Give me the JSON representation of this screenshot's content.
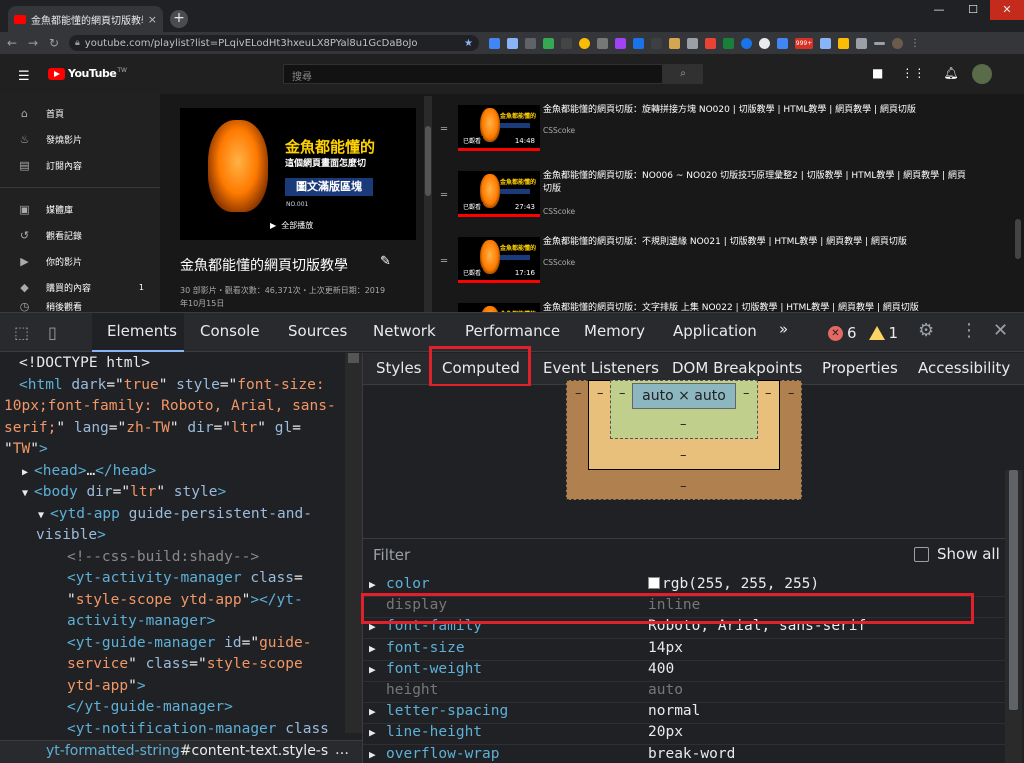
{
  "browser": {
    "tab_title": "金魚都能懂的網頁切版教學 - You",
    "tab_close": "×",
    "new_tab": "+",
    "win_min": "—",
    "win_max": "☐",
    "win_close": "✕",
    "url": "youtube.com/playlist?list=PLqivELodHt3hxeuLX8PYal8u1GcDaBoJo",
    "ext_badge": "999+"
  },
  "youtube": {
    "logo": "YouTube",
    "logo_region": "TW",
    "search_placeholder": "搜尋",
    "guide": [
      {
        "label": "首頁",
        "icon": "home-icon"
      },
      {
        "label": "發燒影片",
        "icon": "trending-icon"
      },
      {
        "label": "訂閱內容",
        "icon": "subscriptions-icon"
      },
      {
        "label": "媒體庫",
        "icon": "library-icon"
      },
      {
        "label": "觀看記錄",
        "icon": "history-icon"
      },
      {
        "label": "你的影片",
        "icon": "your-videos-icon"
      },
      {
        "label": "購買的內容",
        "icon": "purchases-icon",
        "count": "1"
      },
      {
        "label": "稍後觀看",
        "icon": "watch-later-icon"
      }
    ],
    "playlist": {
      "thumb_line1": "金魚都能懂的",
      "thumb_line2": "這個網頁畫面怎麼切",
      "thumb_line3": "圖文滿版區塊",
      "thumb_line4": "NO.001",
      "play_all": "全部播放",
      "title": "金魚都能懂的網頁切版教學",
      "meta": "30 部影片・觀看次數：46,371次・上次更新日期：2019年10月15日"
    },
    "videos": [
      {
        "title": "金魚都能懂的網頁切版：旋轉拼接方塊 NO020 | 切版教學 | HTML教學 | 網頁教學 | 網頁切版",
        "channel": "CSScoke",
        "watched": "已觀看",
        "duration": "14:48"
      },
      {
        "title": "金魚都能懂的網頁切版：NO006 ~ NO020 切版技巧原理彙整2 | 切版教學 | HTML教學 | 網頁教學 | 網頁切版",
        "channel": "CSScoke",
        "watched": "已觀看",
        "duration": "27:43"
      },
      {
        "title": "金魚都能懂的網頁切版：不規則邊緣 NO021 | 切版教學 | HTML教學 | 網頁教學 | 網頁切版",
        "channel": "CSScoke",
        "watched": "已觀看",
        "duration": "17:16"
      },
      {
        "title": "金魚都能懂的網頁切版：文字排版 上集 NO022 | 切版教學 | HTML教學 | 網頁教學 | 網頁切版",
        "channel": "",
        "watched": "",
        "duration": ""
      }
    ]
  },
  "devtools": {
    "tabs": [
      "Elements",
      "Console",
      "Sources",
      "Network",
      "Performance",
      "Memory",
      "Application"
    ],
    "more_tabs": "»",
    "errors": "6",
    "warnings": "1",
    "subtabs": [
      "Styles",
      "Computed",
      "Event Listeners",
      "DOM Breakpoints",
      "Properties",
      "Accessibility"
    ],
    "box_content": "auto × auto",
    "dash": "–",
    "filter_placeholder": "Filter",
    "show_all": "Show all",
    "computed": [
      {
        "name": "color",
        "value": "rgb(255, 255, 255)",
        "expandable": true,
        "swatch": "#ffffff"
      },
      {
        "name": "display",
        "value": "inline",
        "expandable": false,
        "dim": true
      },
      {
        "name": "font-family",
        "value": "Roboto, Arial, sans-serif",
        "expandable": true
      },
      {
        "name": "font-size",
        "value": "14px",
        "expandable": true
      },
      {
        "name": "font-weight",
        "value": "400",
        "expandable": true
      },
      {
        "name": "height",
        "value": "auto",
        "expandable": false,
        "dim": true
      },
      {
        "name": "letter-spacing",
        "value": "normal",
        "expandable": true
      },
      {
        "name": "line-height",
        "value": "20px",
        "expandable": true
      },
      {
        "name": "overflow-wrap",
        "value": "break-word",
        "expandable": true
      }
    ],
    "breadcrumb_tag": "yt-formatted-string",
    "breadcrumb_rest": "#content-text.style-s",
    "breadcrumb_more": "…"
  }
}
